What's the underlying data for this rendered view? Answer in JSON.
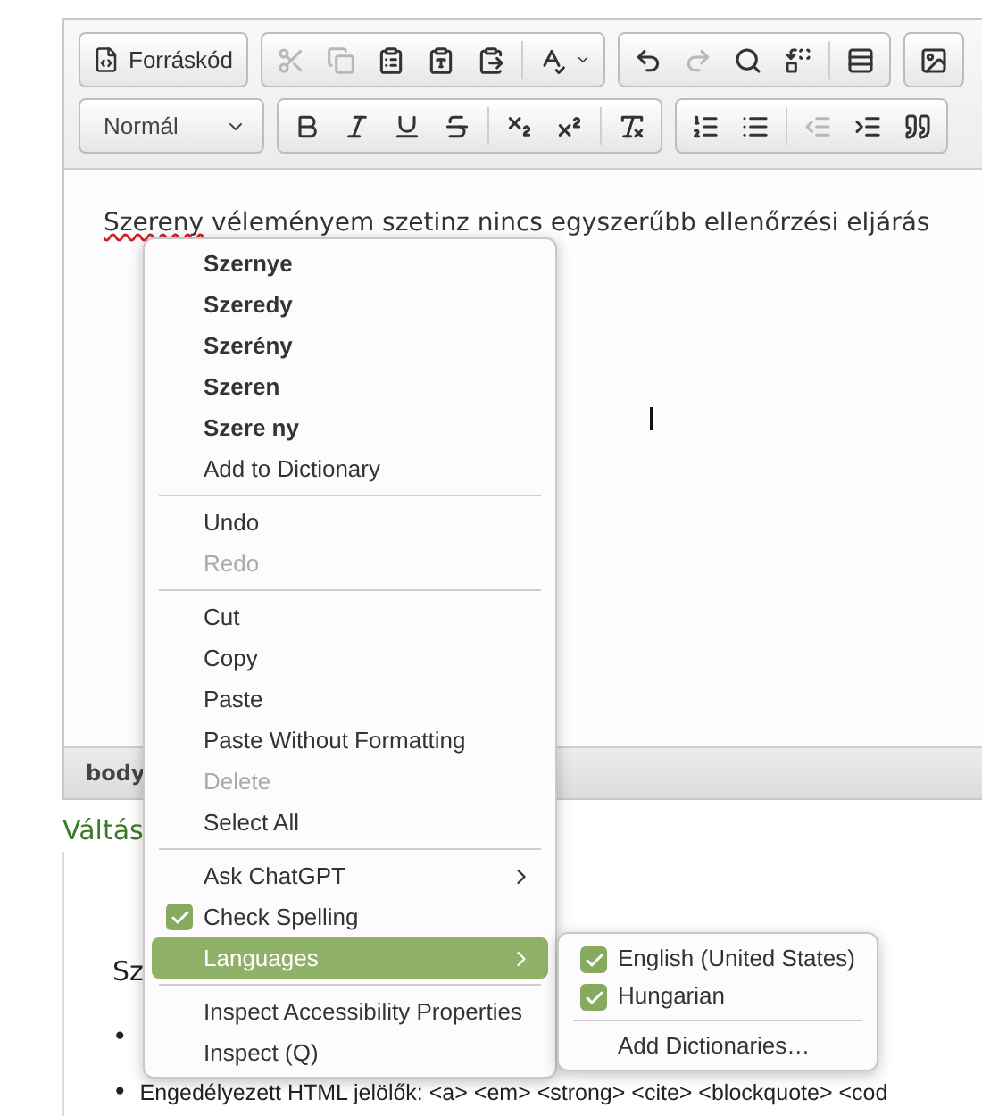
{
  "toolbar": {
    "rows": [
      [
        {
          "items": [
            {
              "kind": "source",
              "label": "Forráskód",
              "disabled": false
            }
          ]
        },
        {
          "items": [
            {
              "kind": "cut",
              "disabled": true
            },
            {
              "kind": "copy",
              "disabled": true
            },
            {
              "kind": "paste",
              "disabled": false
            },
            {
              "kind": "paste-text",
              "disabled": false
            },
            {
              "kind": "paste-word",
              "disabled": false
            },
            {
              "kind": "separator"
            },
            {
              "kind": "spellcheck",
              "disabled": false
            }
          ]
        },
        {
          "items": [
            {
              "kind": "undo",
              "disabled": false
            },
            {
              "kind": "redo",
              "disabled": true
            },
            {
              "kind": "find",
              "disabled": false
            },
            {
              "kind": "replace",
              "disabled": false
            },
            {
              "kind": "separator"
            },
            {
              "kind": "blocks",
              "disabled": false
            }
          ]
        },
        {
          "items": [
            {
              "kind": "image",
              "disabled": false
            }
          ]
        }
      ],
      [
        {
          "items": [
            {
              "kind": "format-select",
              "label": "Normál"
            }
          ]
        },
        {
          "items": [
            {
              "kind": "bold",
              "disabled": false
            },
            {
              "kind": "italic",
              "disabled": false
            },
            {
              "kind": "underline",
              "disabled": false
            },
            {
              "kind": "strike",
              "disabled": false
            },
            {
              "kind": "separator"
            },
            {
              "kind": "subscript",
              "disabled": false
            },
            {
              "kind": "superscript",
              "disabled": false
            },
            {
              "kind": "separator"
            },
            {
              "kind": "clear-format",
              "disabled": false
            }
          ]
        },
        {
          "items": [
            {
              "kind": "ordered-list",
              "disabled": false
            },
            {
              "kind": "bullet-list",
              "disabled": false
            },
            {
              "kind": "separator"
            },
            {
              "kind": "outdent",
              "disabled": true
            },
            {
              "kind": "indent",
              "disabled": false
            },
            {
              "kind": "quote",
              "disabled": false
            }
          ]
        }
      ]
    ]
  },
  "editor": {
    "misspelled": "Szereny",
    "rest": "véleményem szetinz nincs egyszerűbb ellenőrzési eljárás"
  },
  "status_bar": {
    "path": "body"
  },
  "toggle_link": "Váltás",
  "below": {
    "paragraph": "Sz",
    "bullets": [
      {
        "marker": "•"
      },
      {
        "marker": "•",
        "text": "Engedélyezett HTML jelölők: <a> <em> <strong> <cite> <blockquote> <cod"
      }
    ]
  },
  "context_menu": {
    "items": [
      {
        "kind": "suggestion",
        "label": "Szernye"
      },
      {
        "kind": "suggestion",
        "label": "Szeredy"
      },
      {
        "kind": "suggestion",
        "label": "Szerény"
      },
      {
        "kind": "suggestion",
        "label": "Szeren"
      },
      {
        "kind": "suggestion",
        "label": "Szere ny"
      },
      {
        "kind": "item",
        "label": "Add to Dictionary",
        "disabled": false
      },
      {
        "kind": "separator"
      },
      {
        "kind": "item",
        "label": "Undo",
        "disabled": false
      },
      {
        "kind": "item",
        "label": "Redo",
        "disabled": true
      },
      {
        "kind": "separator"
      },
      {
        "kind": "item",
        "label": "Cut",
        "disabled": false
      },
      {
        "kind": "item",
        "label": "Copy",
        "disabled": false
      },
      {
        "kind": "item",
        "label": "Paste",
        "disabled": false
      },
      {
        "kind": "item",
        "label": "Paste Without Formatting",
        "disabled": false
      },
      {
        "kind": "item",
        "label": "Delete",
        "disabled": true
      },
      {
        "kind": "item",
        "label": "Select All",
        "disabled": false
      },
      {
        "kind": "separator"
      },
      {
        "kind": "submenu",
        "label": "Ask ChatGPT",
        "selected": false
      },
      {
        "kind": "checkbox",
        "label": "Check Spelling",
        "checked": true
      },
      {
        "kind": "submenu",
        "label": "Languages",
        "selected": true
      },
      {
        "kind": "separator"
      },
      {
        "kind": "item",
        "label": "Inspect Accessibility Properties",
        "disabled": false
      },
      {
        "kind": "item",
        "label": "Inspect (Q)",
        "disabled": false
      }
    ]
  },
  "submenu": {
    "items": [
      {
        "kind": "checkbox",
        "label": "English (United States)",
        "checked": true
      },
      {
        "kind": "checkbox",
        "label": "Hungarian",
        "checked": true
      },
      {
        "kind": "separator"
      },
      {
        "kind": "item",
        "label": "Add Dictionaries…",
        "disabled": false
      }
    ]
  }
}
